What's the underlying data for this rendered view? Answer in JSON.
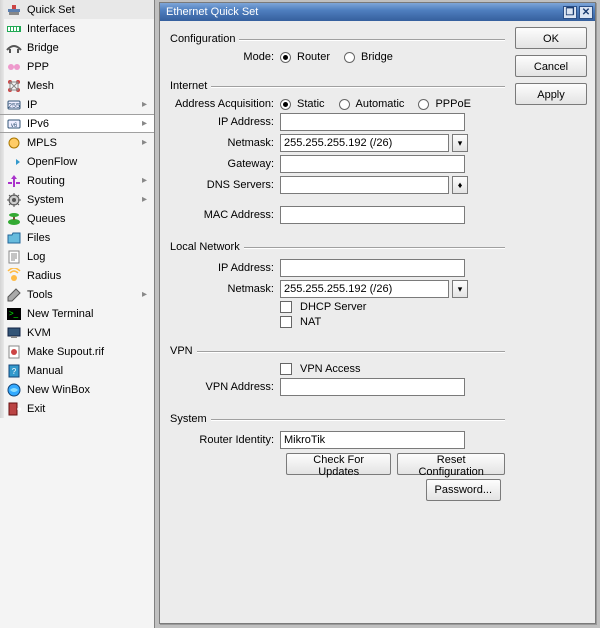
{
  "sidebar": {
    "items": [
      {
        "label": "Quick Set",
        "icon": "quickset",
        "sub": false
      },
      {
        "label": "Interfaces",
        "icon": "interfaces",
        "sub": false
      },
      {
        "label": "Bridge",
        "icon": "bridge",
        "sub": false
      },
      {
        "label": "PPP",
        "icon": "ppp",
        "sub": false
      },
      {
        "label": "Mesh",
        "icon": "mesh",
        "sub": false
      },
      {
        "label": "IP",
        "icon": "ip",
        "sub": true
      },
      {
        "label": "IPv6",
        "icon": "ipv6",
        "sub": true,
        "active": true
      },
      {
        "label": "MPLS",
        "icon": "mpls",
        "sub": true
      },
      {
        "label": "OpenFlow",
        "icon": "openflow",
        "sub": false
      },
      {
        "label": "Routing",
        "icon": "routing",
        "sub": true
      },
      {
        "label": "System",
        "icon": "system",
        "sub": true
      },
      {
        "label": "Queues",
        "icon": "queues",
        "sub": false
      },
      {
        "label": "Files",
        "icon": "files",
        "sub": false
      },
      {
        "label": "Log",
        "icon": "log",
        "sub": false
      },
      {
        "label": "Radius",
        "icon": "radius",
        "sub": false
      },
      {
        "label": "Tools",
        "icon": "tools",
        "sub": true
      },
      {
        "label": "New Terminal",
        "icon": "terminal",
        "sub": false
      },
      {
        "label": "KVM",
        "icon": "kvm",
        "sub": false
      },
      {
        "label": "Make Supout.rif",
        "icon": "supout",
        "sub": false
      },
      {
        "label": "Manual",
        "icon": "manual",
        "sub": false
      },
      {
        "label": "New WinBox",
        "icon": "winbox",
        "sub": false
      },
      {
        "label": "Exit",
        "icon": "exit",
        "sub": false
      }
    ]
  },
  "window": {
    "title": "Ethernet Quick Set",
    "buttons": {
      "ok": "OK",
      "cancel": "Cancel",
      "apply": "Apply"
    }
  },
  "groups": {
    "configuration": {
      "title": "Configuration",
      "mode_label": "Mode:",
      "options": {
        "router": "Router",
        "bridge": "Bridge"
      },
      "selected": "router"
    },
    "internet": {
      "title": "Internet",
      "acq_label": "Address Acquisition:",
      "acq_options": {
        "static": "Static",
        "automatic": "Automatic",
        "pppoe": "PPPoE"
      },
      "acq_selected": "static",
      "ip_label": "IP Address:",
      "ip_value": "",
      "netmask_label": "Netmask:",
      "netmask_value": "255.255.255.192 (/26)",
      "gateway_label": "Gateway:",
      "gateway_value": "",
      "dns_label": "DNS Servers:",
      "dns_value": "",
      "mac_label": "MAC Address:",
      "mac_value": ""
    },
    "local": {
      "title": "Local Network",
      "ip_label": "IP Address:",
      "ip_value": "",
      "netmask_label": "Netmask:",
      "netmask_value": "255.255.255.192 (/26)",
      "dhcp_label": "DHCP Server",
      "dhcp_checked": false,
      "nat_label": "NAT",
      "nat_checked": false
    },
    "vpn": {
      "title": "VPN",
      "access_label": "VPN Access",
      "access_checked": false,
      "addr_label": "VPN Address:",
      "addr_value": ""
    },
    "system": {
      "title": "System",
      "identity_label": "Router Identity:",
      "identity_value": "MikroTik",
      "check_updates": "Check For Updates",
      "reset_config": "Reset Configuration",
      "password": "Password..."
    }
  }
}
